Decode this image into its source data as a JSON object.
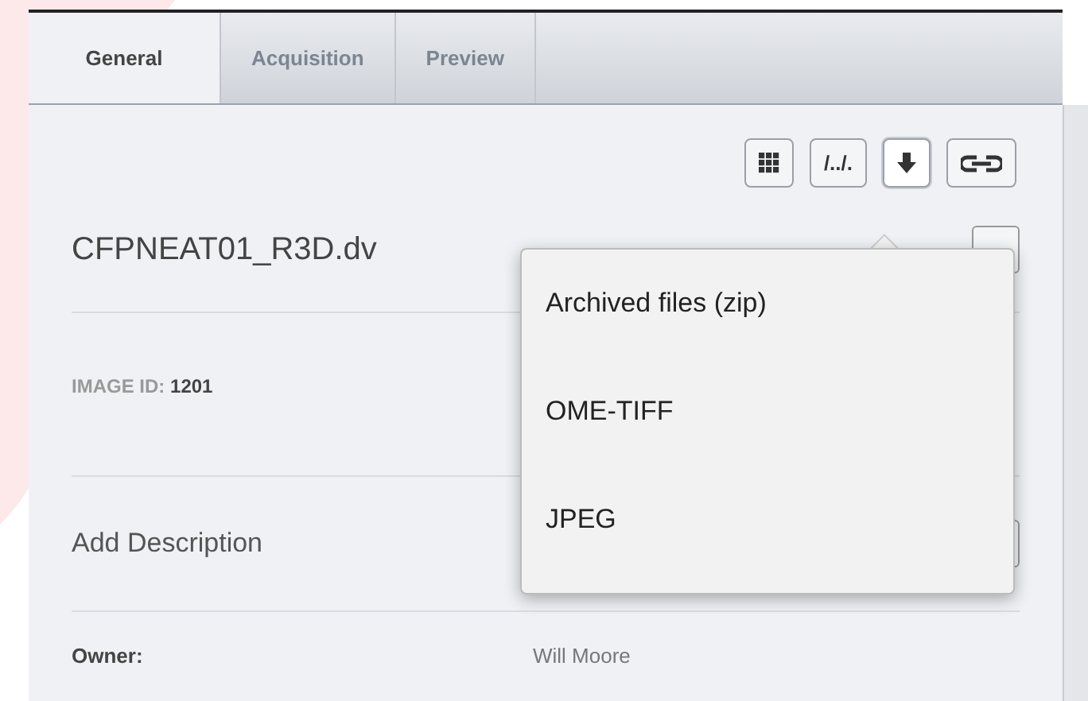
{
  "tabs": [
    {
      "label": "General",
      "selected": true
    },
    {
      "label": "Acquisition",
      "selected": false
    },
    {
      "label": "Preview",
      "selected": false
    }
  ],
  "toolbar": [
    {
      "kind": "grid"
    },
    {
      "kind": "text",
      "label": "/../."
    },
    {
      "kind": "download",
      "selected": true
    },
    {
      "kind": "link"
    }
  ],
  "image_name": "CFPNEAT01_R3D.dv",
  "image_id": {
    "label": "IMAGE ID:",
    "value": "1201"
  },
  "description_placeholder": "Add Description",
  "owner": {
    "label": "Owner:",
    "value": "Will Moore"
  },
  "download_menu": [
    "Archived files (zip)",
    "OME-TIFF",
    "JPEG"
  ]
}
